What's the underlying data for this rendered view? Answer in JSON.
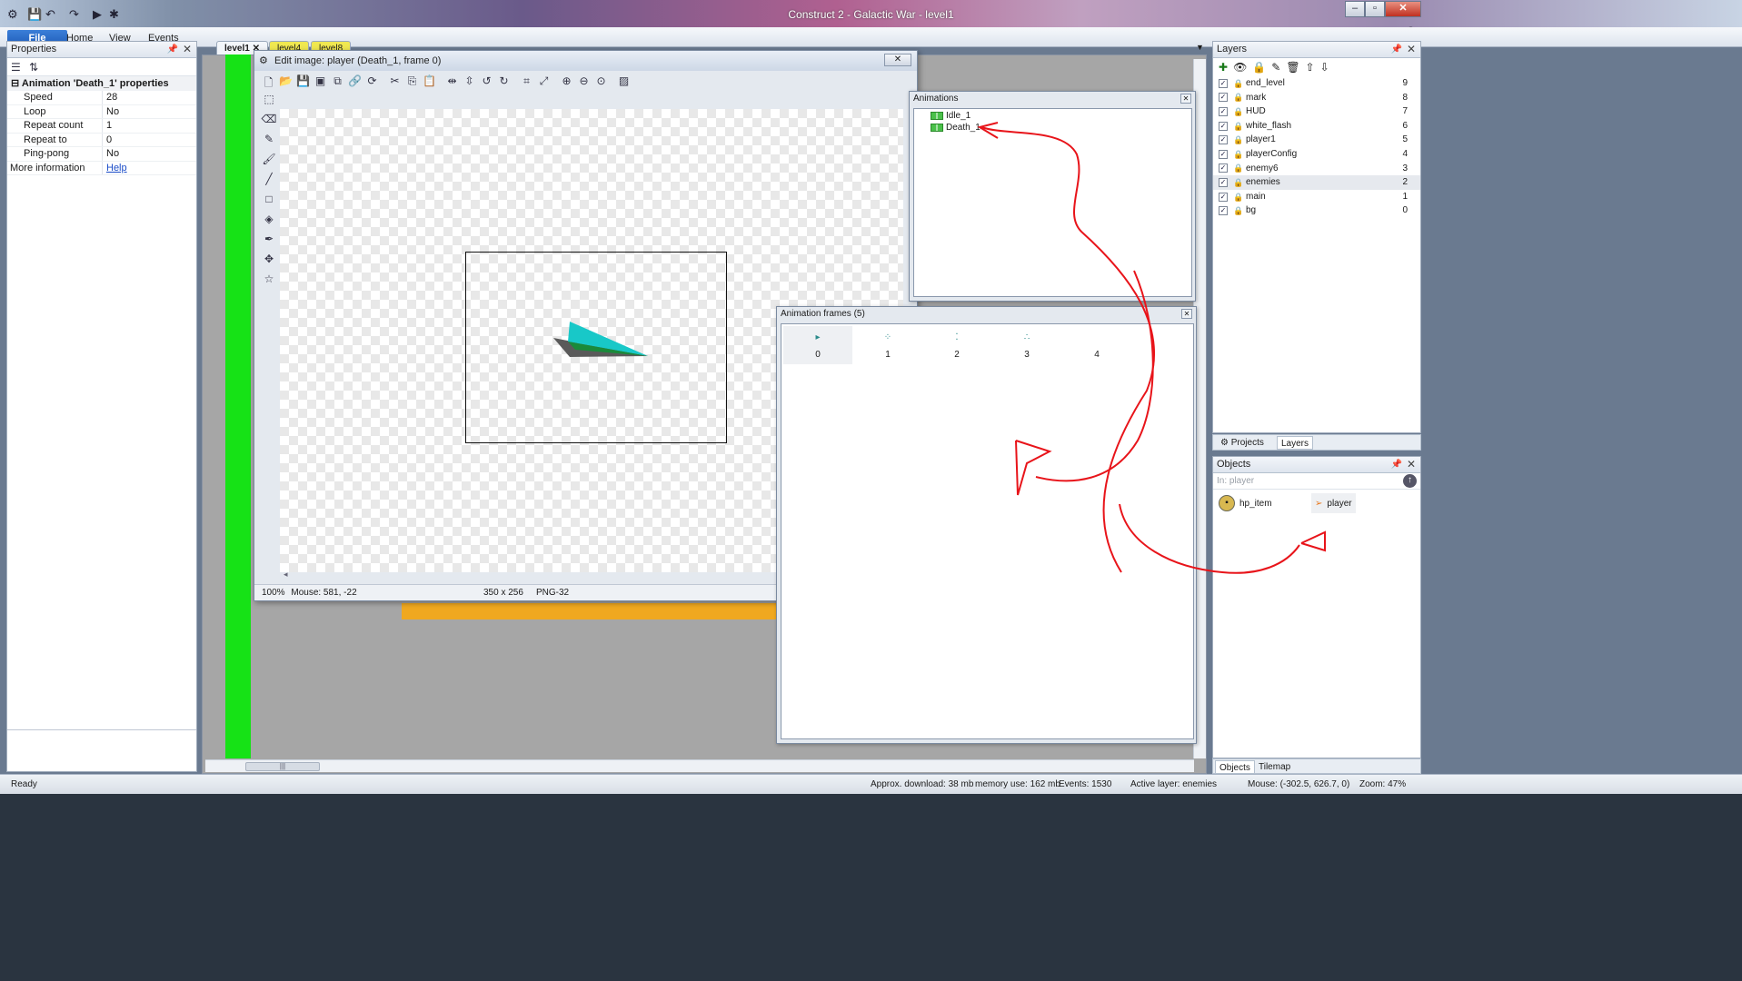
{
  "window": {
    "title": "Construct 2 - Galactic War - level1",
    "minimize": "–",
    "maximize": "▫",
    "close": "✕"
  },
  "ribbon": {
    "tabs": [
      {
        "label": "File"
      },
      {
        "label": "Home"
      },
      {
        "label": "View"
      },
      {
        "label": "Events"
      }
    ]
  },
  "properties": {
    "title": "Properties",
    "section": "Animation 'Death_1' properties",
    "rows": [
      {
        "key": "Speed",
        "value": "28"
      },
      {
        "key": "Loop",
        "value": "No"
      },
      {
        "key": "Repeat count",
        "value": "1"
      },
      {
        "key": "Repeat to",
        "value": "0"
      },
      {
        "key": "Ping-pong",
        "value": "No"
      }
    ],
    "more_info_label": "More information",
    "help_link": "Help"
  },
  "doc_tabs": [
    {
      "label": "level1",
      "active": true,
      "color": "#f3f6fa"
    },
    {
      "label": "level4",
      "active": false,
      "color": "#f0e850"
    },
    {
      "label": "level8",
      "active": false,
      "color": "#f0e850"
    }
  ],
  "edit_image": {
    "title": "Edit image: player (Death_1, frame 0)",
    "close": "✕",
    "status": {
      "zoom": "100%",
      "mouse": "Mouse: 581, -22",
      "size": "350 x 256",
      "format": "PNG-32"
    }
  },
  "animations": {
    "title": "Animations",
    "items": [
      {
        "label": "Idle_1"
      },
      {
        "label": "Death_1"
      }
    ]
  },
  "animation_frames": {
    "title": "Animation frames (5)",
    "frames": [
      "0",
      "1",
      "2",
      "3",
      "4"
    ]
  },
  "layers": {
    "title": "Layers",
    "rows": [
      {
        "name": "end_level",
        "index": "9"
      },
      {
        "name": "mark",
        "index": "8"
      },
      {
        "name": "HUD",
        "index": "7"
      },
      {
        "name": "white_flash",
        "index": "6"
      },
      {
        "name": "player1",
        "index": "5"
      },
      {
        "name": "playerConfig",
        "index": "4"
      },
      {
        "name": "enemy6",
        "index": "3"
      },
      {
        "name": "enemies",
        "index": "2"
      },
      {
        "name": "main",
        "index": "1"
      },
      {
        "name": "bg",
        "index": "0"
      }
    ],
    "tabs": [
      "Projects",
      "Layers"
    ]
  },
  "objects": {
    "title": "Objects",
    "filter_placeholder": "In: player",
    "items": [
      {
        "name": "hp_item"
      },
      {
        "name": "player"
      }
    ],
    "tabs": [
      "Objects",
      "Tilemap"
    ]
  },
  "statusbar": {
    "ready": "Ready",
    "download": "Approx. download: 38 mb",
    "memory": "memory use: 162 mb",
    "events": "Events: 1530",
    "active_layer": "Active layer: enemies",
    "mouse": "Mouse: (-302.5, 626.7, 0)",
    "zoom": "Zoom: 47%"
  },
  "colors": {
    "accent": "#1e5cb8",
    "green_strip": "#16e216",
    "annotation": "#e8141a",
    "sprite_cyan": "#18c8c8",
    "sprite_gray": "#5a5a5a"
  }
}
